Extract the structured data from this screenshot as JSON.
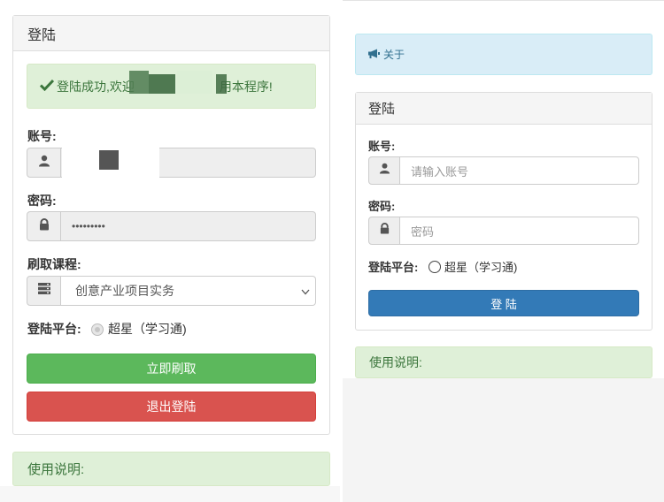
{
  "left": {
    "panel_title": "登陆",
    "success_msg": {
      "prefix": "登陆成功,欢迎",
      "suffix": "用本程序!"
    },
    "account_label": "账号:",
    "password_label": "密码:",
    "password_value": "•••••••••",
    "course_label": "刷取课程:",
    "course_value": "创意产业项目实务",
    "platform_label": "登陆平台:",
    "platform_option": "超星（学习通)",
    "start_button": "立即刷取",
    "logout_button": "退出登陆",
    "usage_label": "使用说明:"
  },
  "right": {
    "about_label": "关于",
    "panel_title": "登陆",
    "account_label": "账号:",
    "account_placeholder": "请输入账号",
    "password_label": "密码:",
    "password_placeholder": "密码",
    "platform_label": "登陆平台:",
    "platform_option": "超星（学习通)",
    "login_button": "登 陆",
    "usage_label": "使用说明:"
  },
  "icons": {
    "check": "check-icon",
    "user": "user-icon",
    "lock": "lock-icon",
    "list": "list-icon",
    "chevron": "chevron-down-icon",
    "bullhorn": "bullhorn-icon"
  },
  "colors": {
    "success": "#5cb85c",
    "danger": "#d9534f",
    "primary": "#337ab7",
    "alert_success_bg": "#dff0d8",
    "alert_info_bg": "#d9edf7"
  }
}
